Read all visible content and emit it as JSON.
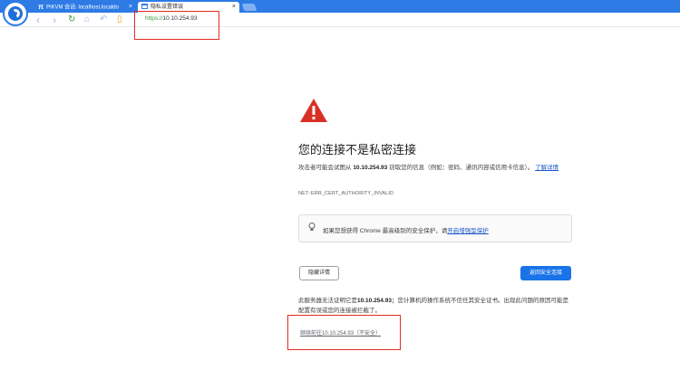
{
  "browser": {
    "tabs": [
      {
        "icon": "π",
        "label": "PiKVM 会话: localhost.localdo"
      },
      {
        "icon": "",
        "label": "隐私设置错误"
      }
    ],
    "tab_close": "×",
    "address_scheme": "https://",
    "address_host": "10.10.254.93",
    "nav": {
      "back": "‹",
      "forward": "›",
      "reload": "↻",
      "home": "⌂",
      "undo": "↶",
      "bookmarks": "▯"
    }
  },
  "page": {
    "title": "您的连接不是私密连接",
    "desc_prefix": "攻击者可能会试图从 ",
    "desc_host": "10.10.254.93",
    "desc_suffix": " 窃取您的信息（例如：密码、通讯内容或信用卡信息）。",
    "learn_more": "了解详情",
    "error_code": "NET::ERR_CERT_AUTHORITY_INVALID",
    "safe_prefix": "如果您想获得 Chrome 最高级别的安全保护，请",
    "safe_link": "开启增强型保护",
    "details_button": "隐藏详情",
    "back_button": "返回安全连接",
    "explain_prefix": "此服务器无法证明它是",
    "explain_host": "10.10.254.93",
    "explain_suffix": "；您计算机的操作系统不信任其安全证书。出现此问题的原因可能是配置有误或您的连接被拦截了。",
    "proceed_link": "继续前往10.10.254.93（不安全）"
  },
  "colors": {
    "accent": "#1a73e8",
    "warning": "#d93025",
    "highlight_box": "#e52b1f",
    "titlebar": "#2e7be6"
  }
}
